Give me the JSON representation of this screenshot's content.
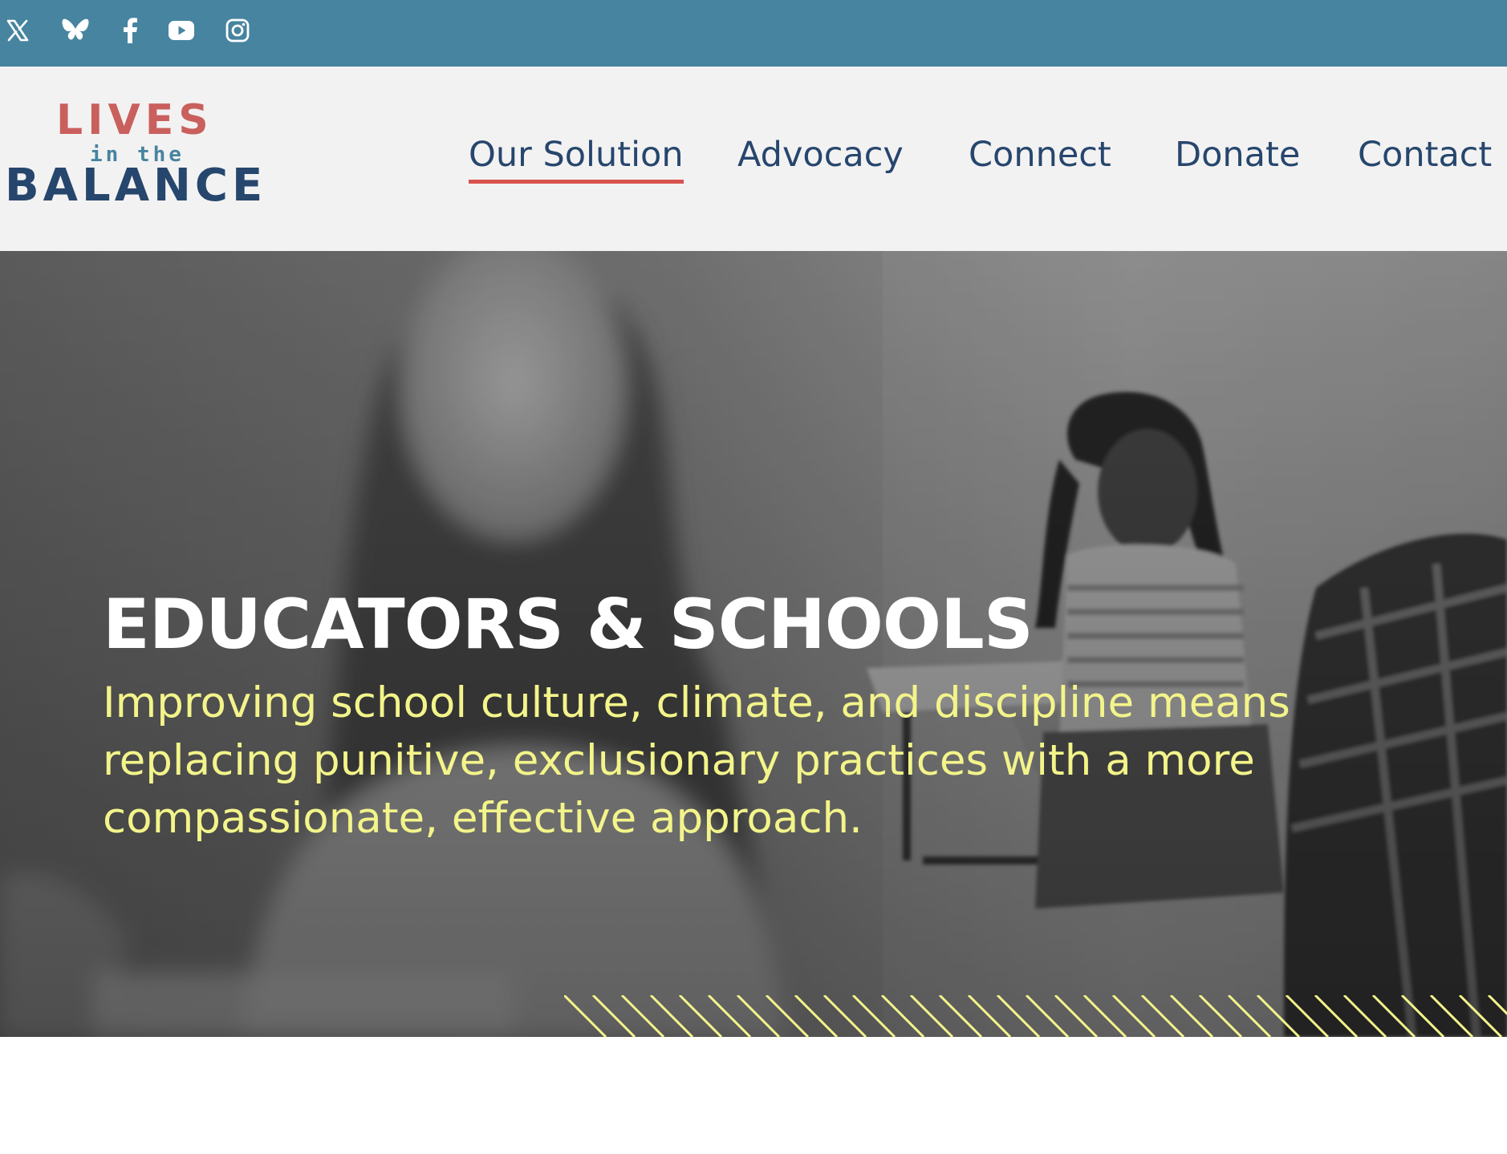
{
  "social": {
    "icons": [
      "x-twitter-icon",
      "bluesky-icon",
      "facebook-icon",
      "youtube-icon",
      "instagram-icon"
    ]
  },
  "logo": {
    "line1": "LIVES",
    "line2": "in the",
    "line3": "BALANCE"
  },
  "nav": {
    "items": [
      {
        "label": "Our Solution",
        "active": true
      },
      {
        "label": "Advocacy"
      },
      {
        "label": "Connect"
      },
      {
        "label": "Donate"
      },
      {
        "label": "Contact"
      }
    ]
  },
  "hero": {
    "title": "EDUCATORS & SCHOOLS",
    "subtitle": "Improving school culture, climate, and discipline means replacing punitive, exclusionary practices with a more compassionate, effective approach."
  },
  "colors": {
    "social_bar": "#47849f",
    "header_bg": "#f3f2f2",
    "nav_text": "#26466d",
    "nav_active_underline": "#d9534f",
    "logo_lives": "#c9605d",
    "logo_inthe": "#47849f",
    "logo_balance": "#26466d",
    "hero_title": "#ffffff",
    "hero_subtitle": "#f3f48a",
    "stripes": "#f3f48a"
  }
}
